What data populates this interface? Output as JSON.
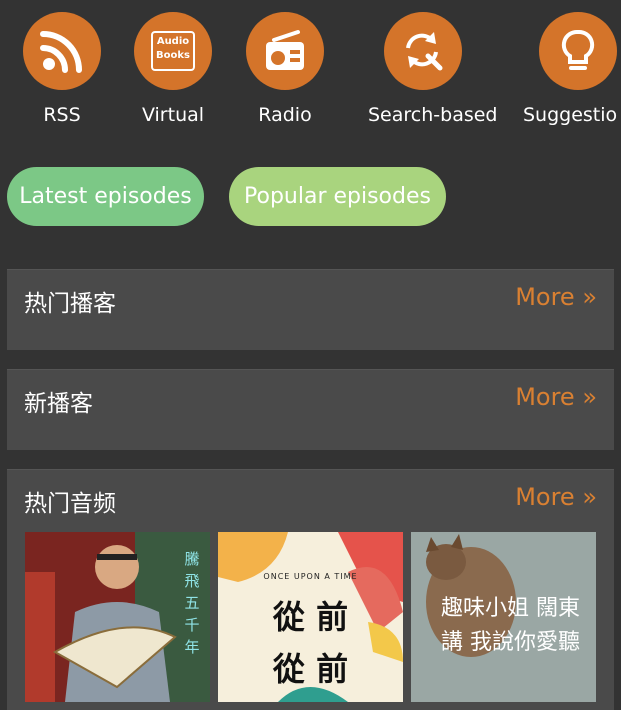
{
  "categories": [
    {
      "label": "RSS",
      "icon": "rss-icon"
    },
    {
      "label": "Virtual",
      "icon": "audiobooks-icon",
      "icon_text_1": "Audio",
      "icon_text_2": "Books"
    },
    {
      "label": "Radio",
      "icon": "radio-icon"
    },
    {
      "label": "Search-based",
      "icon": "search-refresh-icon"
    },
    {
      "label": "Suggestio",
      "icon": "lightbulb-icon"
    }
  ],
  "chips": {
    "latest": "Latest episodes",
    "popular": "Popular episodes"
  },
  "sections": [
    {
      "title": "热门播客",
      "more": "More »"
    },
    {
      "title": "新播客",
      "more": "More »"
    },
    {
      "title": "热门音频",
      "more": "More »"
    }
  ],
  "covers": [
    {
      "text": "騰飛五千年"
    },
    {
      "kicker": "ONCE UPON A TIME",
      "line1": "從 前",
      "line2": "從 前"
    },
    {
      "text": "趣味小姐 闊東講 我說你愛聽"
    }
  ],
  "colors": {
    "accent": "#d4742a",
    "more": "#d98032",
    "chip_latest": "#7cc886",
    "chip_popular": "#a9d47e",
    "background": "#333333",
    "section": "#4a4a4a"
  }
}
